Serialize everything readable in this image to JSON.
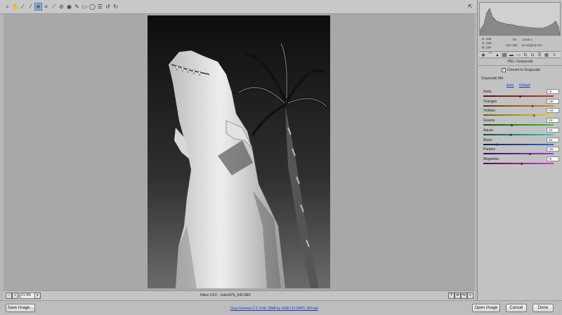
{
  "toolbar": {
    "tools": [
      {
        "icon": "zoom-icon",
        "glyph": "⌕"
      },
      {
        "icon": "hand-icon",
        "glyph": "✋"
      },
      {
        "icon": "white-balance-icon",
        "glyph": "⁄"
      },
      {
        "icon": "color-sampler-icon",
        "glyph": "⁄"
      },
      {
        "icon": "targeted-adjustment-icon",
        "glyph": "⊕",
        "active": true
      },
      {
        "icon": "crop-icon",
        "glyph": "⌗"
      },
      {
        "icon": "straighten-icon",
        "glyph": "⟋"
      },
      {
        "icon": "spot-removal-icon",
        "glyph": "⊘"
      },
      {
        "icon": "red-eye-icon",
        "glyph": "◉"
      },
      {
        "icon": "adjustment-brush-icon",
        "glyph": "✎"
      },
      {
        "icon": "graduated-filter-icon",
        "glyph": "▭"
      },
      {
        "icon": "radial-filter-icon",
        "glyph": "◯"
      },
      {
        "icon": "preferences-icon",
        "glyph": "☰"
      },
      {
        "icon": "rotate-left-icon",
        "glyph": "↺"
      },
      {
        "icon": "rotate-right-icon",
        "glyph": "↻"
      }
    ],
    "fullscreen_icon": "fullscreen-icon"
  },
  "preview": {
    "zoom": "21.9%",
    "filename": "Nikon D2X - JoboGPS_045.NEF"
  },
  "histogram": {
    "r_label": "R:",
    "r_value": "239",
    "g_label": "G:",
    "g_value": "239",
    "b_label": "B:",
    "b_value": "239",
    "aperture": "f/8",
    "shutter": "1/400 s",
    "iso": "ISO 100",
    "lens": "10-24@10 mm"
  },
  "panel": {
    "section_title": "HSL / Grayscale",
    "convert_label": "Convert to Grayscale",
    "convert_checked": true,
    "mix_label": "Grayscale Mix",
    "auto_label": "Auto",
    "default_label": "Default",
    "sliders": [
      {
        "label": "Reds",
        "value": "+5",
        "amount": 5,
        "gradient": "linear-gradient(90deg,#5a1010,#d23232)"
      },
      {
        "label": "Oranges",
        "value": "+40",
        "amount": 40,
        "gradient": "linear-gradient(90deg,#5a3410,#e2892c)"
      },
      {
        "label": "Yellows",
        "value": "+44",
        "amount": 44,
        "gradient": "linear-gradient(90deg,#6a6210,#e2da30)"
      },
      {
        "label": "Greens",
        "value": "-19",
        "amount": -19,
        "gradient": "linear-gradient(90deg,#154a15,#3cc23c)"
      },
      {
        "label": "Aquas",
        "value": "-22",
        "amount": -22,
        "gradient": "linear-gradient(90deg,#104a4a,#32c8c8)"
      },
      {
        "label": "Blues",
        "value": "-62",
        "amount": -62,
        "gradient": "linear-gradient(90deg,#10204a,#3262d8)"
      },
      {
        "label": "Purples",
        "value": "+33",
        "amount": 33,
        "gradient": "linear-gradient(90deg,#30104a,#9a3ad8)"
      },
      {
        "label": "Magentas",
        "value": "+9",
        "amount": 9,
        "gradient": "linear-gradient(90deg,#4a1040,#d83ac0)"
      }
    ]
  },
  "footer": {
    "save_label": "Save Image...",
    "workflow_link": "Gray Gamma 2.2; 8 bit; 2848 by 4288 (12.2MP); 300 ppi",
    "open_label": "Open Image",
    "cancel_label": "Cancel",
    "done_label": "Done"
  }
}
